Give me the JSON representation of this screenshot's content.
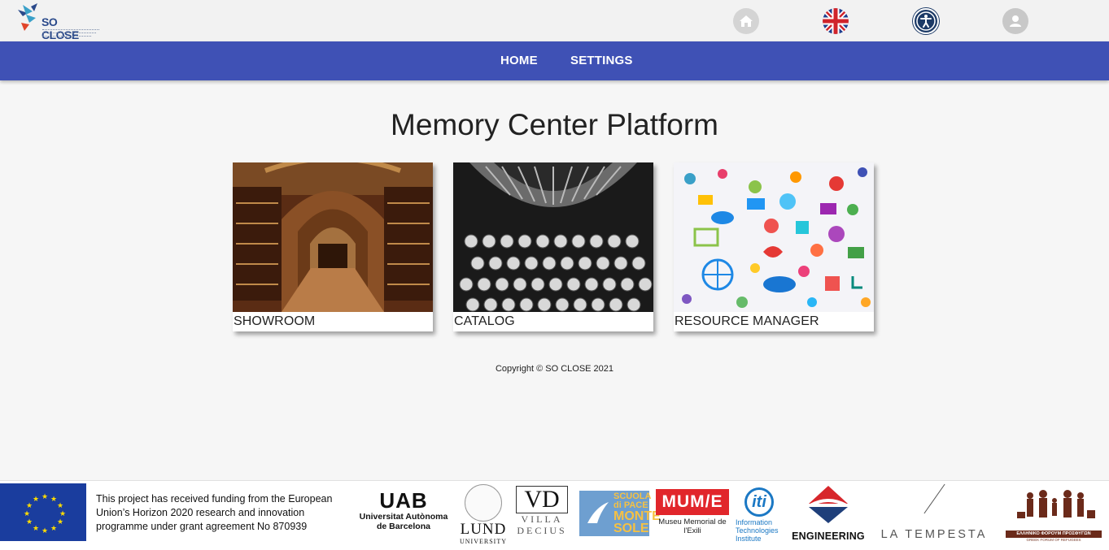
{
  "header": {
    "logo_text": "SO CLOSE",
    "logo_alt": "SO CLOSE logo",
    "icons": {
      "home": "home-icon",
      "language": "uk-flag-icon",
      "accessibility": "accessibility-icon",
      "user": "user-icon"
    }
  },
  "nav": {
    "items": [
      {
        "label": "HOME"
      },
      {
        "label": "SETTINGS"
      }
    ],
    "color": "#3f51b5"
  },
  "main": {
    "title": "Memory Center Platform",
    "cards": [
      {
        "label": "SHOWROOM",
        "image": "library-arches-photo"
      },
      {
        "label": "CATALOG",
        "image": "typewriter-keys-photo"
      },
      {
        "label": "RESOURCE MANAGER",
        "image": "social-media-icons-collage"
      }
    ],
    "copyright": "Copyright © SO CLOSE 2021"
  },
  "footer": {
    "funding_text": "This project has received funding from the European Union’s Horizon 2020 research and innovation programme under grant agreement No 870939",
    "partners": {
      "uab_big": "UAB",
      "uab_small": "Universitat Autònoma de Barcelona",
      "lund_big": "LUND",
      "lund_small": "UNIVERSITY",
      "villa_mono": "VD",
      "villa_small": "VILLA DECIUS",
      "scuola_line1": "SCUOLA",
      "scuola_line2": "di PACE",
      "scuola_line3": "MONTE",
      "scuola_line4": "SOLE",
      "mume_big": "MUM/E",
      "mume_small": "Museu Memorial de l'Exili",
      "iti_mark": "iti",
      "iti_small": "Information Technologies Institute",
      "eng_small": "ENGINEERING",
      "tempesta": "LA TEMPESTA",
      "forum_band": "ΕΛΛΗΝΙΚΟ ΦΟΡΟΥΜ ΠΡΟΣΦΥΓΩΝ",
      "forum_band2": "GREEK FORUM OF REFUGEES"
    }
  }
}
